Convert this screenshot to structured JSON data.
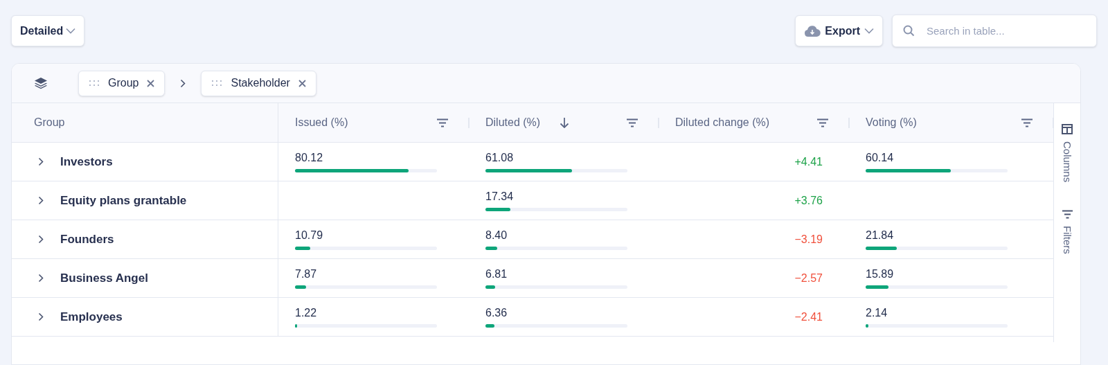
{
  "view_select": {
    "label": "Detailed"
  },
  "export_button": {
    "label": "Export"
  },
  "search": {
    "placeholder": "Search in table..."
  },
  "grouping": [
    {
      "label": "Group"
    },
    {
      "label": "Stakeholder"
    }
  ],
  "table": {
    "columns": [
      {
        "label": "Group",
        "filter": false,
        "sorted": false
      },
      {
        "label": "Issued (%)",
        "filter": true,
        "sorted": false
      },
      {
        "label": "Diluted (%)",
        "filter": true,
        "sorted": true
      },
      {
        "label": "Diluted change (%)",
        "filter": true,
        "sorted": false
      },
      {
        "label": "Voting (%)",
        "filter": true,
        "sorted": false
      }
    ],
    "rows": [
      {
        "group": "Investors",
        "expanded": false,
        "issued": {
          "value": "80.12",
          "level": 0.8012
        },
        "diluted": {
          "value": "61.08",
          "level": 0.6108
        },
        "change": {
          "value": "+4.41",
          "positive": true
        },
        "voting": {
          "value": "60.14",
          "level": 0.6014
        }
      },
      {
        "group": "Equity plans grantable",
        "expanded": false,
        "diluted": {
          "value": "17.34",
          "level": 0.1734
        },
        "change": {
          "value": "+3.76",
          "positive": true
        }
      },
      {
        "group": "Founders",
        "expanded": false,
        "issued": {
          "value": "10.79",
          "level": 0.1079
        },
        "diluted": {
          "value": "8.40",
          "level": 0.084
        },
        "change": {
          "value": "−3.19",
          "positive": false
        },
        "voting": {
          "value": "21.84",
          "level": 0.2184
        }
      },
      {
        "group": "Business Angel",
        "expanded": false,
        "issued": {
          "value": "7.87",
          "level": 0.0787
        },
        "diluted": {
          "value": "6.81",
          "level": 0.0681
        },
        "change": {
          "value": "−2.57",
          "positive": false
        },
        "voting": {
          "value": "15.89",
          "level": 0.1589
        }
      },
      {
        "group": "Employees",
        "expanded": false,
        "issued": {
          "value": "1.22",
          "level": 0.0122
        },
        "diluted": {
          "value": "6.36",
          "level": 0.0636
        },
        "change": {
          "value": "−2.41",
          "positive": false
        },
        "voting": {
          "value": "2.14",
          "level": 0.0214
        }
      }
    ]
  },
  "side_panel": [
    {
      "label": "Columns",
      "kind": "columns"
    },
    {
      "label": "Filters",
      "kind": "filters"
    }
  ]
}
